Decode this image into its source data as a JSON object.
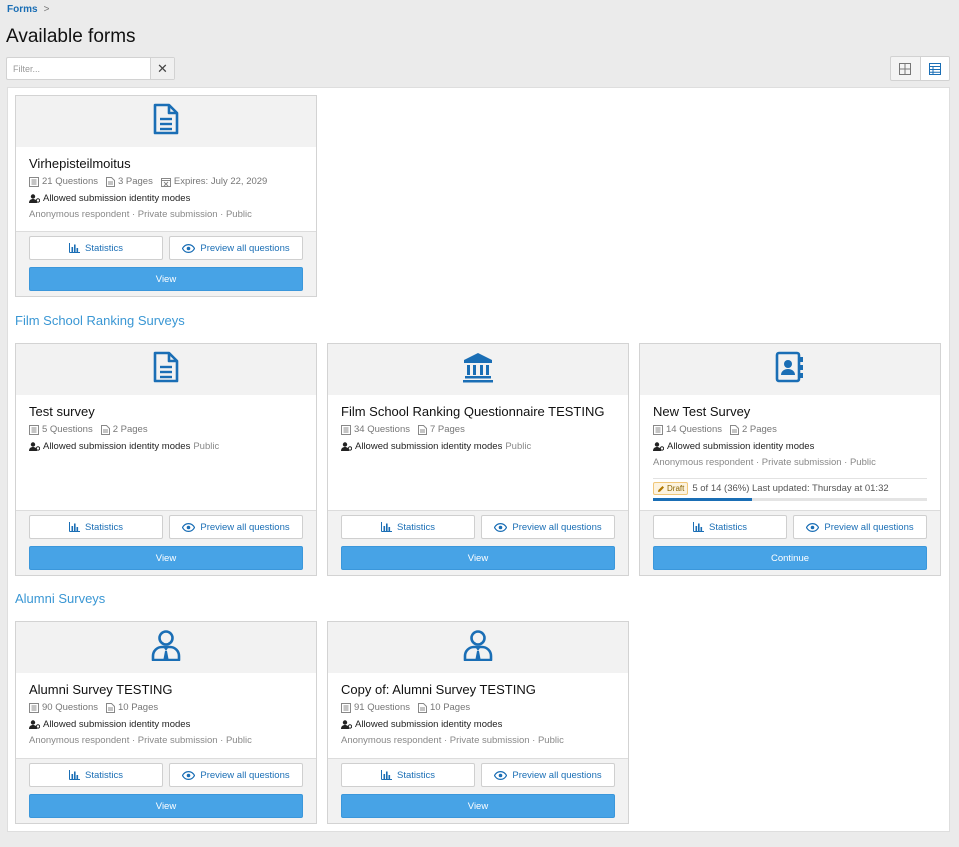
{
  "breadcrumb": {
    "root": "Forms",
    "separator": ">"
  },
  "page_title": "Available forms",
  "filter": {
    "placeholder": "Filter...",
    "value": "",
    "clear_label": "✕"
  },
  "colors": {
    "accent": "#1a6eb5",
    "button": "#47a3e6",
    "group": "#3a97d4"
  },
  "labels": {
    "allowed_modes": "Allowed submission identity modes",
    "statistics": "Statistics",
    "preview": "Preview all questions",
    "view": "View",
    "continue": "Continue"
  },
  "ungrouped": [
    {
      "icon": "document-icon",
      "title": "Virhepisteilmoitus",
      "questions": "21 Questions",
      "pages": "3 Pages",
      "expires": "Expires: July 22, 2029",
      "modes_inline": "",
      "modes_detail": "Anonymous respondent · Private submission · Public"
    }
  ],
  "groups": [
    {
      "title": "Film School Ranking Surveys",
      "cards": [
        {
          "icon": "document-icon",
          "title": "Test survey",
          "questions": "5 Questions",
          "pages": "2 Pages",
          "modes_inline": "Public",
          "modes_detail": ""
        },
        {
          "icon": "institution-icon",
          "title": "Film School Ranking Questionnaire TESTING",
          "questions": "34 Questions",
          "pages": "7 Pages",
          "modes_inline": "Public",
          "modes_detail": ""
        },
        {
          "icon": "contact-book-icon",
          "title": "New Test Survey",
          "questions": "14 Questions",
          "pages": "2 Pages",
          "modes_inline": "",
          "modes_detail": "Anonymous respondent · Private submission · Public",
          "draft": {
            "badge": "Draft",
            "text": "5 of 14 (36%) Last updated: Thursday at 01:32",
            "progress": 0.36
          }
        }
      ]
    },
    {
      "title": "Alumni Surveys",
      "cards": [
        {
          "icon": "user-tie-icon",
          "title": "Alumni Survey TESTING",
          "questions": "90 Questions",
          "pages": "10 Pages",
          "modes_inline": "",
          "modes_detail": "Anonymous respondent · Private submission · Public"
        },
        {
          "icon": "user-tie-icon",
          "title": "Copy of: Alumni Survey TESTING",
          "questions": "91 Questions",
          "pages": "10 Pages",
          "modes_inline": "",
          "modes_detail": "Anonymous respondent · Private submission · Public"
        }
      ]
    }
  ]
}
